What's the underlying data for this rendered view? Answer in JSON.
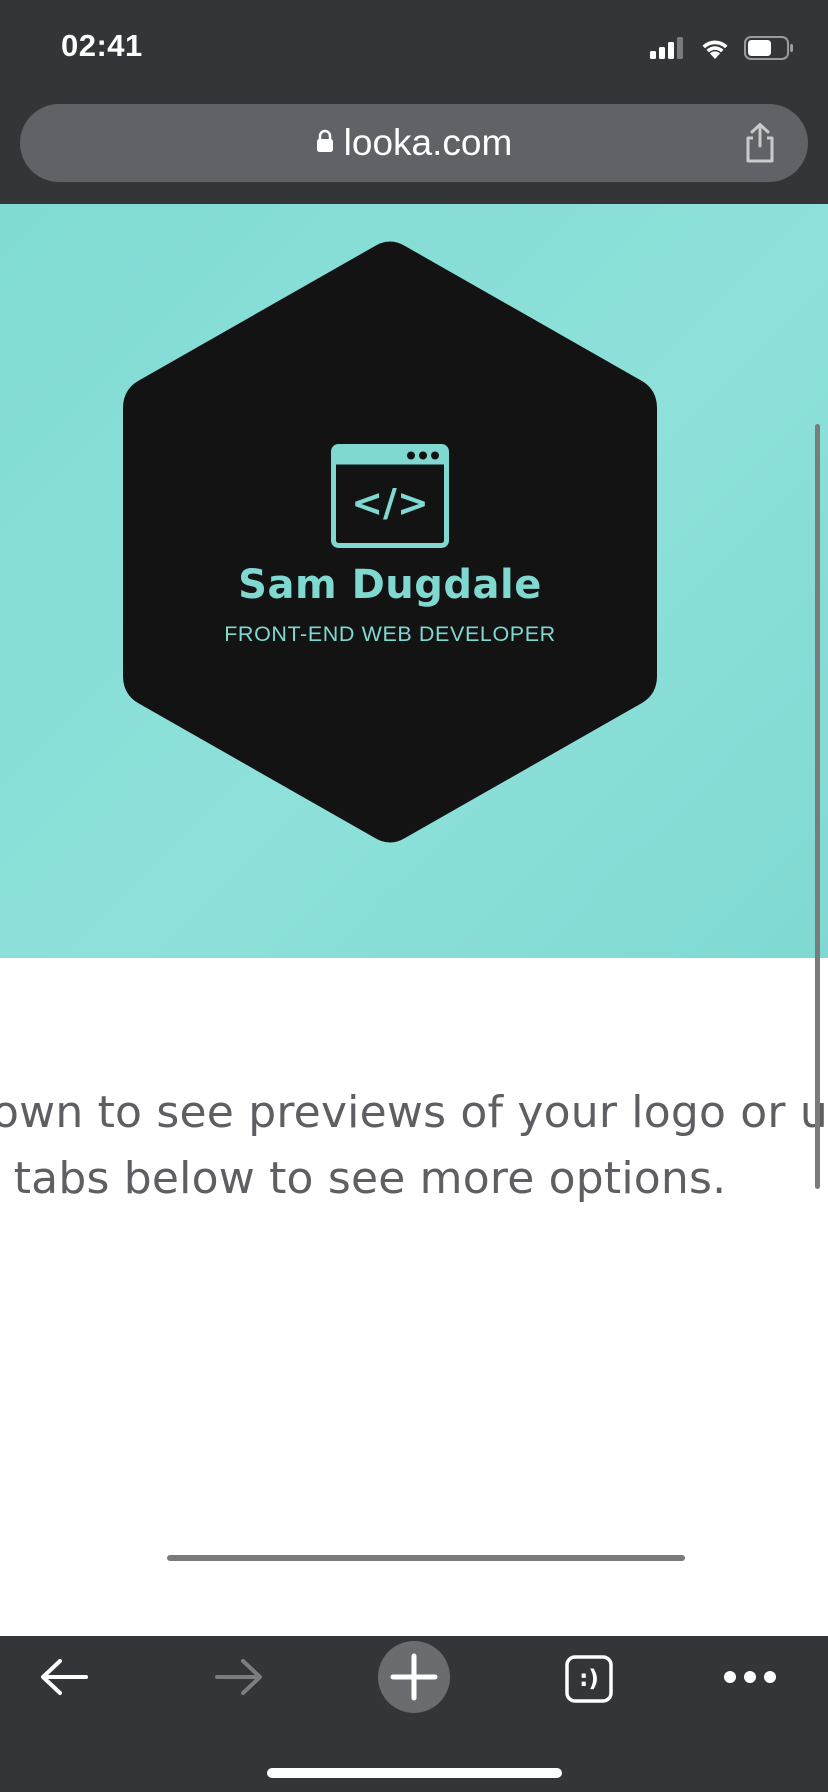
{
  "status_bar": {
    "time": "02:41",
    "icons": [
      "cellular-signal-icon",
      "wifi-icon",
      "battery-icon"
    ]
  },
  "browser": {
    "url": "looka.com",
    "lock_icon": "lock-icon",
    "share_icon": "share-icon"
  },
  "logo_preview": {
    "name": "Sam Dugdale",
    "tagline": "FRONT-END WEB DEVELOPER",
    "icon": "code-window-icon",
    "code_symbol": "</>",
    "colors": {
      "background": "#8ee1da",
      "badge": "#131313",
      "accent": "#7fd9d1"
    }
  },
  "instructions": {
    "line1": "own to see previews of your logo or u",
    "line2": "tabs below to see more options."
  },
  "toolbar": {
    "back_icon": "back-arrow-icon",
    "forward_icon": "forward-arrow-icon",
    "new_tab_icon": "plus-icon",
    "tabs_label": ":)",
    "more_icon": "more-dots-icon"
  }
}
